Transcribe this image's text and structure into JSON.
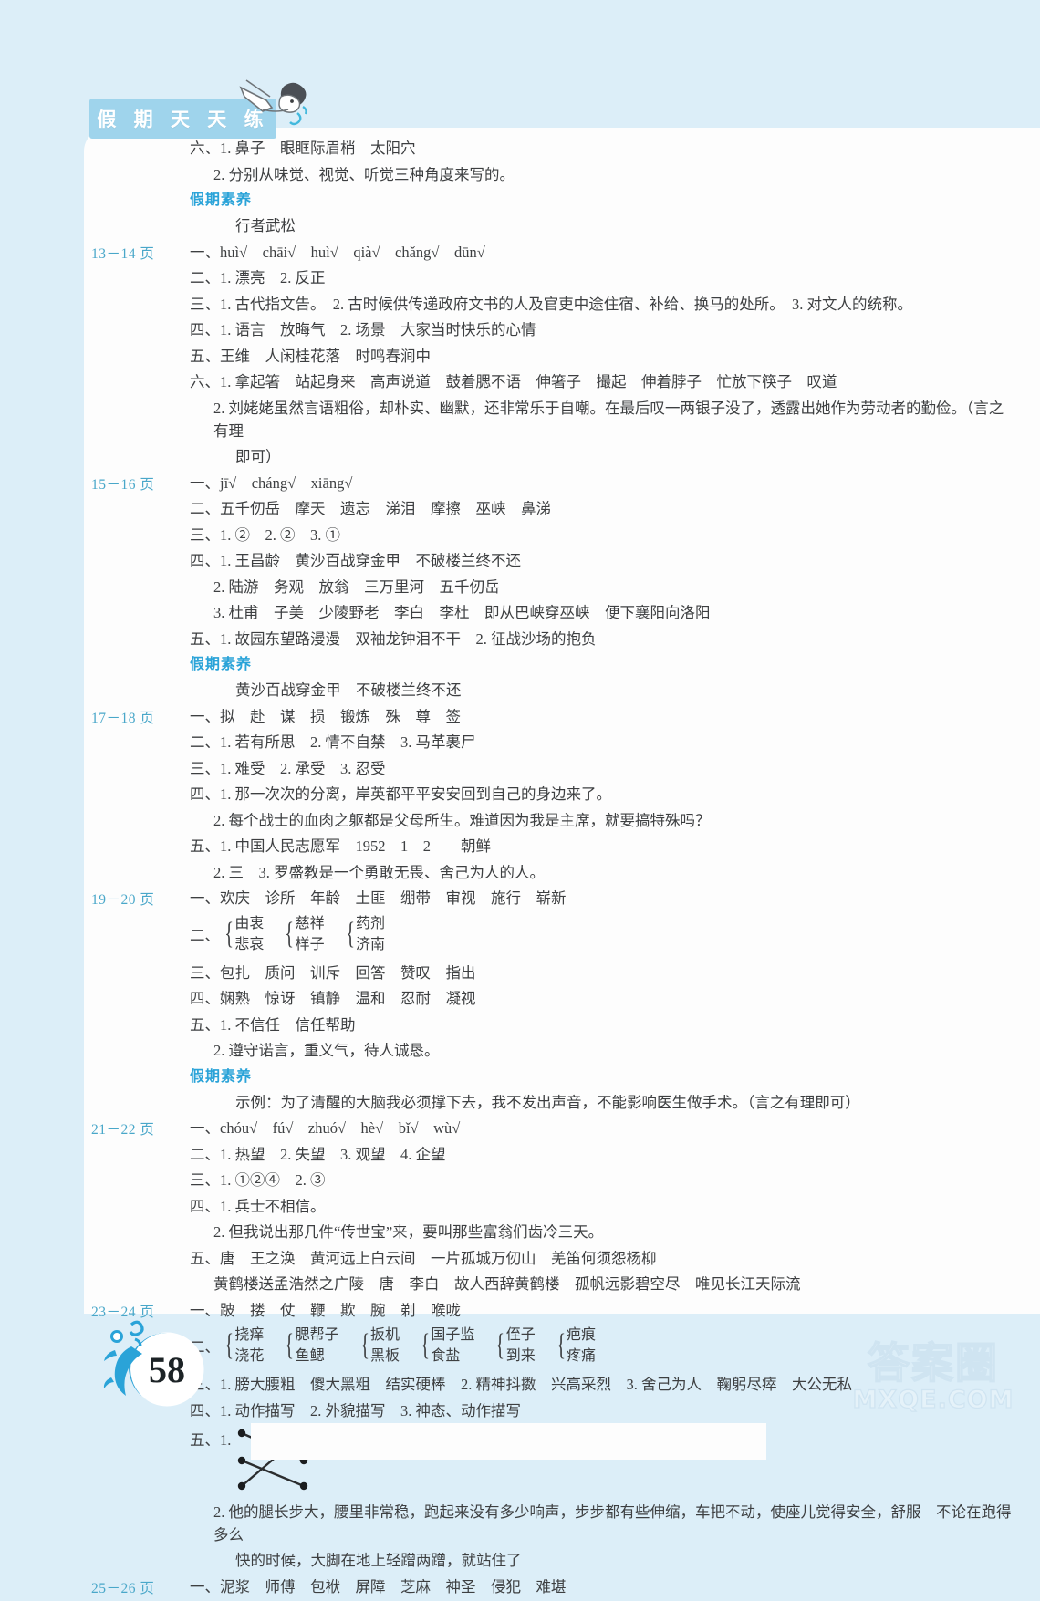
{
  "header": {
    "title": "假 期 天 天 练",
    "mascot_icon": "swimming-boy-icon"
  },
  "page_number": "58",
  "watermark": {
    "line1": "答案圈",
    "line2": "MXQE.COM"
  },
  "colors": {
    "background": "#dceef8",
    "sheet": "#fdfdfd",
    "accent_blue": "#2aa3d8",
    "page_label_blue": "#49a7c9",
    "title_chip": "#9fd4ec",
    "text": "#3d3f41"
  },
  "intro": {
    "lines": [
      "六、1. 鼻子　眼眶际眉梢　太阳穴",
      "2. 分别从味觉、视觉、听觉三种角度来写的。"
    ],
    "sub_heading": "假期素养",
    "sub_answer": "行者武松"
  },
  "sections": [
    {
      "page_label": "13－14 页",
      "lines": [
        "一、huì√　chāi√　huì√　qià√　chǎng√　dūn√",
        "二、1. 漂亮　2. 反正",
        "三、1. 古代指文告。　2. 古时候供传递政府文书的人及官吏中途住宿、补给、换马的处所。　3. 对文人的统称。",
        "四、1. 语言　放晦气　2. 场景　大家当时快乐的心情",
        "五、王维　人闲桂花落　时鸣春涧中",
        "六、1. 拿起箸　站起身来　高声说道　鼓着腮不语　伸箸子　撮起　伸着脖子　忙放下筷子　叹道"
      ],
      "indent_lines": [
        "2. 刘姥姥虽然言语粗俗，却朴实、幽默，还非常乐于自嘲。在最后叹一两银子没了，透露出她作为劳动者的勤俭。（言之有理",
        "即可）"
      ]
    },
    {
      "page_label": "15－16 页",
      "lines": [
        "一、jī√　cháng√　xiāng√",
        "二、五千仞岳　摩天　遗忘　涕泪　摩擦　巫峡　鼻涕",
        "三、1. ②　2. ②　3. ①",
        "四、1. 王昌龄　黄沙百战穿金甲　不破楼兰终不还"
      ],
      "indent_lines": [
        "2. 陆游　务观　放翁　三万里河　五千仞岳",
        "3. 杜甫　子美　少陵野老　李白　李杜　即从巴峡穿巫峡　便下襄阳向洛阳"
      ],
      "tail_lines": [
        "五、1. 故园东望路漫漫　双袖龙钟泪不干　2. 征战沙场的抱负"
      ],
      "sub_heading": "假期素养",
      "sub_answer": "黄沙百战穿金甲　不破楼兰终不还"
    },
    {
      "page_label": "17－18 页",
      "lines": [
        "一、拟　赴　谋　损　锻炼　殊　尊　签",
        "二、1. 若有所思　2. 情不自禁　3. 马革裹尸",
        "三、1. 难受　2. 承受　3. 忍受",
        "四、1. 那一次次的分离，岸英都平平安安回到自己的身边来了。"
      ],
      "indent_lines": [
        "2. 每个战士的血肉之躯都是父母所生。难道因为我是主席，就要搞特殊吗？"
      ],
      "tail_lines": [
        "五、1. 中国人民志愿军　1952　1　2　　朝鲜"
      ],
      "tail_indent_lines": [
        "2. 三　3. 罗盛教是一个勇敢无畏、舍己为人的人。"
      ]
    },
    {
      "page_label": "19－20 页",
      "lines": [
        "一、欢庆　诊所　年龄　土匪　绷带　审视　施行　崭新"
      ],
      "brace_block": {
        "lead": "二、",
        "groups": [
          {
            "top": "由衷",
            "bottom": "悲哀"
          },
          {
            "top": "慈祥",
            "bottom": "样子"
          },
          {
            "top": "药剂",
            "bottom": "济南"
          }
        ]
      },
      "after_brace_lines": [
        "三、包扎　质问　训斥　回答　赞叹　指出",
        "四、娴熟　惊讶　镇静　温和　忍耐　凝视",
        "五、1. 不信任　信任帮助"
      ],
      "indent_lines": [
        "2. 遵守诺言，重义气，待人诚恳。"
      ],
      "sub_heading": "假期素养",
      "sub_answer": "示例：为了清醒的大脑我必须撑下去，我不发出声音，不能影响医生做手术。（言之有理即可）"
    },
    {
      "page_label": "21－22 页",
      "lines": [
        "一、chóu√　fú√　zhuó√　hè√　bǐ√　wù√",
        "二、1. 热望　2. 失望　3. 观望　4. 企望",
        "三、1. ①②④　2. ③",
        "四、1. 兵士不相信。"
      ],
      "indent_lines": [
        "2. 但我说出那几件“传世宝”来，要叫那些富翁们齿冷三天。"
      ],
      "tail_lines": [
        "五、唐　王之涣　黄河远上白云间　一片孤城万仞山　羌笛何须怨杨柳"
      ],
      "tail_indent_lines": [
        "黄鹤楼送孟浩然之广陵　唐　李白　故人西辞黄鹤楼　孤帆远影碧空尽　唯见长江天际流"
      ]
    },
    {
      "page_label": "23－24 页",
      "lines": [
        "一、跛　搂　仗　鞭　欺　腕　剃　喉咙"
      ],
      "brace_block": {
        "lead": "二、",
        "groups": [
          {
            "top": "挠痒",
            "bottom": "浇花"
          },
          {
            "top": "腮帮子",
            "bottom": "鱼鳃"
          },
          {
            "top": "扳机",
            "bottom": "黑板"
          },
          {
            "top": "国子监",
            "bottom": "食盐"
          },
          {
            "top": "侄子",
            "bottom": "到来"
          },
          {
            "top": "疤痕",
            "bottom": "疼痛"
          }
        ]
      },
      "after_brace_lines": [
        "三、1. 膀大腰粗　傻大黑粗　结实硬棒　2. 精神抖擞　兴高采烈　3. 舍己为人　鞠躬尽瘁　大公无私",
        "四、1. 动作描写　2. 外貌描写　3. 神态、动作描写"
      ],
      "match_diagram": {
        "lead": "五、1.",
        "left_dots": 3,
        "right_dots": 3,
        "connections": [
          [
            1,
            2
          ],
          [
            2,
            3
          ],
          [
            3,
            1
          ]
        ]
      },
      "indent_lines": [
        "2. 他的腿长步大，腰里非常稳，跑起来没有多少响声，步步都有些伸缩，车把不动，使座儿觉得安全，舒服　不论在跑得多么",
        "快的时候，大脚在地上轻蹭两蹭，就站住了"
      ]
    },
    {
      "page_label": "25－26 页",
      "lines": [
        "一、泥浆　师傅　包袱　屏障　芝麻　神圣　侵犯　难堪"
      ]
    }
  ]
}
